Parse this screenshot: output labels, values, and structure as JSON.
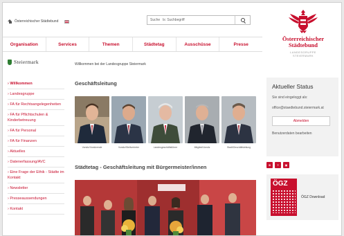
{
  "topbar": {
    "home_label": "Österreichischer Städtebund",
    "search_label": "Suche",
    "search_value": "ls: Suchbegriff"
  },
  "nav": {
    "items": [
      "Organisation",
      "Services",
      "Themen",
      "Städtetag",
      "Ausschüsse",
      "Presse"
    ]
  },
  "logo": {
    "name_line1": "Österreichischer",
    "name_line2": "Städtebund",
    "sub_line1": "LANDESGRUPPE",
    "sub_line2": "STEIERMARK"
  },
  "sidebar": {
    "region": "Steiermark",
    "items": [
      "Willkommen",
      "Landesgruppe",
      "FA für Rechtsangelegenheiten",
      "FA für Pflichtschulen & Kinderbetreuung",
      "FA für Personal",
      "FA für Finanzen",
      "Aktuelles",
      "Datenerfassung/AVC",
      "Eine Frage der Ethik - Städte im Kontakt",
      "Newsletter",
      "Presseaussendungen",
      "Kontakt"
    ]
  },
  "main": {
    "welcome": "Willkommen bei der Landesgruppe Steiermark",
    "section1_title": "Geschäftsleitung",
    "people": [
      {
        "caption": "Vorsitz/Vorsitzende"
      },
      {
        "caption": "Vorsitz/Stellvertreter"
      },
      {
        "caption": "Landesgeschäftsführer"
      },
      {
        "caption": "Mitglied/Vorsitz"
      },
      {
        "caption": "Stadt/Geschäftsleitung"
      }
    ],
    "section2_title": "Städtetag - Geschäftsleitung mit Bürgermeister/innen"
  },
  "right": {
    "status_title": "Aktueller Status",
    "status_text": "Sie sind eingeloggt als:",
    "status_email": "office@staedtebund.steiermark.at",
    "logout_label": "Abmelden",
    "profile_link": "Benutzerdaten bearbeiten",
    "ogz_title": "ÖGZ",
    "ogz_label": "ÖGZ Download"
  },
  "colors": {
    "accent": "#c8102e"
  }
}
